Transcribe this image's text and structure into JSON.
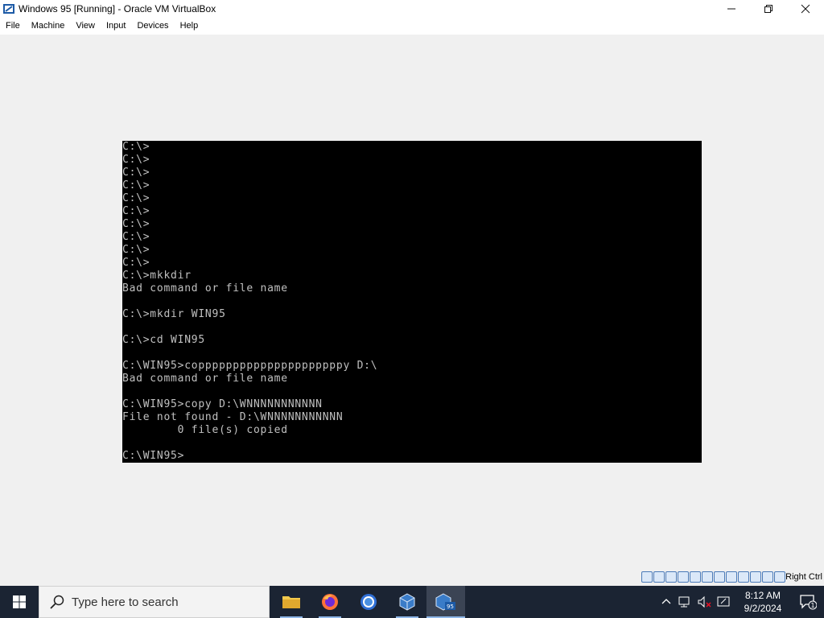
{
  "window": {
    "title": "Windows 95 [Running] - Oracle VM VirtualBox",
    "app_icon": "virtualbox-icon",
    "controls": {
      "minimize": "—",
      "restore": "❐",
      "close": "✕"
    }
  },
  "menu": {
    "items": [
      "File",
      "Machine",
      "View",
      "Input",
      "Devices",
      "Help"
    ]
  },
  "console": {
    "background": "#000000",
    "foreground": "#c0c0c0",
    "lines": [
      "C:\\>",
      "C:\\>",
      "C:\\>",
      "C:\\>",
      "C:\\>",
      "C:\\>",
      "C:\\>",
      "C:\\>",
      "C:\\>",
      "C:\\>",
      "C:\\>mkkdir",
      "Bad command or file name",
      "",
      "C:\\>mkdir WIN95",
      "",
      "C:\\>cd WIN95",
      "",
      "C:\\WIN95>copppppppppppppppppppppy D:\\",
      "Bad command or file name",
      "",
      "C:\\WIN95>copy D:\\WNNNNNNNNNNN",
      "File not found - D:\\WNNNNNNNNNNN",
      "        0 file(s) copied",
      "",
      "C:\\WIN95>"
    ]
  },
  "statusbar": {
    "host_key": "Right Ctrl",
    "icons": [
      "hard-disk-icon",
      "optical-drive-icon",
      "floppy-icon",
      "audio-icon",
      "network-icon",
      "usb-icon",
      "shared-folders-icon",
      "display-icon",
      "video-capture-icon",
      "cpu-icon",
      "mouse-integration-icon",
      "keyboard-icon"
    ]
  },
  "taskbar": {
    "search_placeholder": "Type here to search",
    "apps": [
      "file-explorer-icon",
      "firefox-icon",
      "chrome-icon",
      "virtualbox-icon",
      "windows95-vm-icon"
    ],
    "clock_time": "8:12 AM",
    "clock_date": "9/2/2024",
    "notification_count": "1"
  }
}
